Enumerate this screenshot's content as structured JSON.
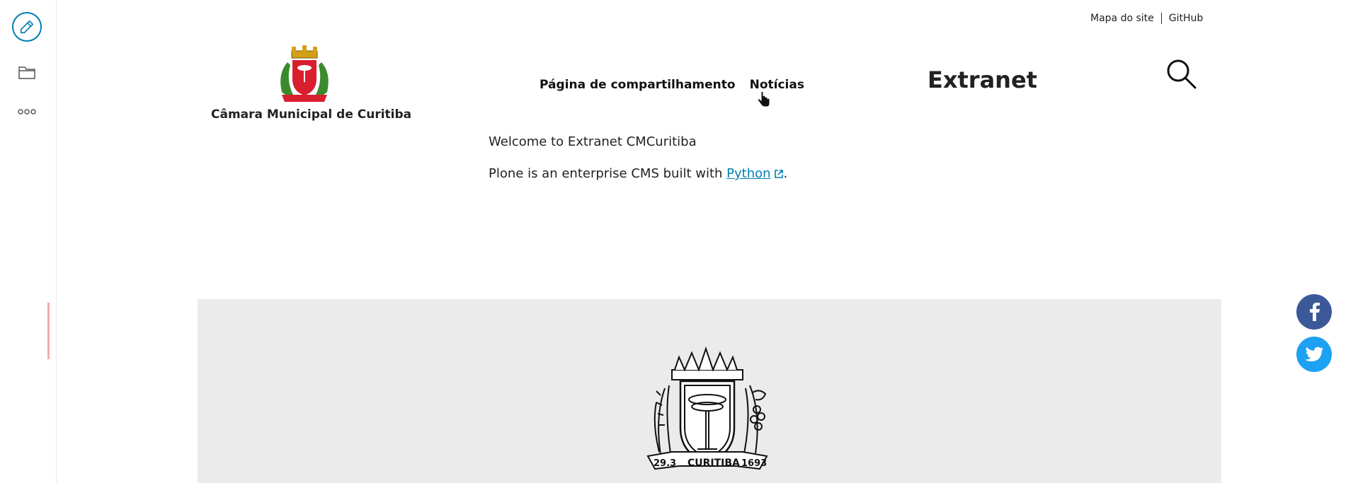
{
  "toolbar": {
    "edit_icon": "pencil-icon",
    "contents_icon": "folder-icon",
    "more_icon": "more-icon",
    "accent_color": "#007eb1"
  },
  "top_links": {
    "sitemap": "Mapa do site",
    "github": "GitHub"
  },
  "site": {
    "name": "Câmara Municipal de Curitiba"
  },
  "nav": {
    "items": [
      {
        "label": "Página de compartilhamento"
      },
      {
        "label": "Notícias"
      }
    ]
  },
  "header": {
    "section_title": "Extranet"
  },
  "content": {
    "welcome": "Welcome to Extranet CMCuritiba",
    "plone_word": "Plone",
    "description_mid": " is an enterprise CMS built with ",
    "python_link": "Python",
    "period": "."
  },
  "social": {
    "facebook": "facebook-icon",
    "twitter": "twitter-icon",
    "facebook_color": "#3b5998",
    "twitter_color": "#1da1f2"
  }
}
